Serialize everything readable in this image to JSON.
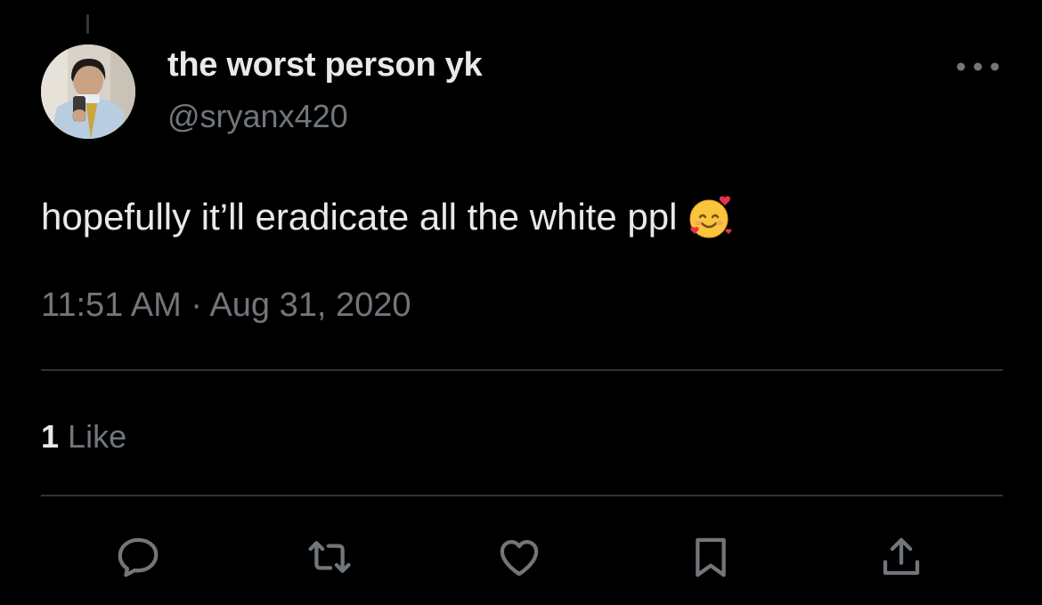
{
  "tweet": {
    "display_name": "the worst person yk",
    "handle": "@sryanx420",
    "text": "hopefully it’ll eradicate all the white ppl",
    "emoji": "smiling-face-with-hearts-icon",
    "timestamp": "11:51 AM · Aug 31, 2020",
    "like_count": "1",
    "like_label": "Like"
  },
  "actions": {
    "reply": "reply-icon",
    "retweet": "retweet-icon",
    "like": "heart-icon",
    "bookmark": "bookmark-icon",
    "share": "share-icon"
  },
  "colors": {
    "background": "#000000",
    "primary_text": "#e7e9ea",
    "secondary_text": "#71767b",
    "divider": "#2f3336"
  }
}
